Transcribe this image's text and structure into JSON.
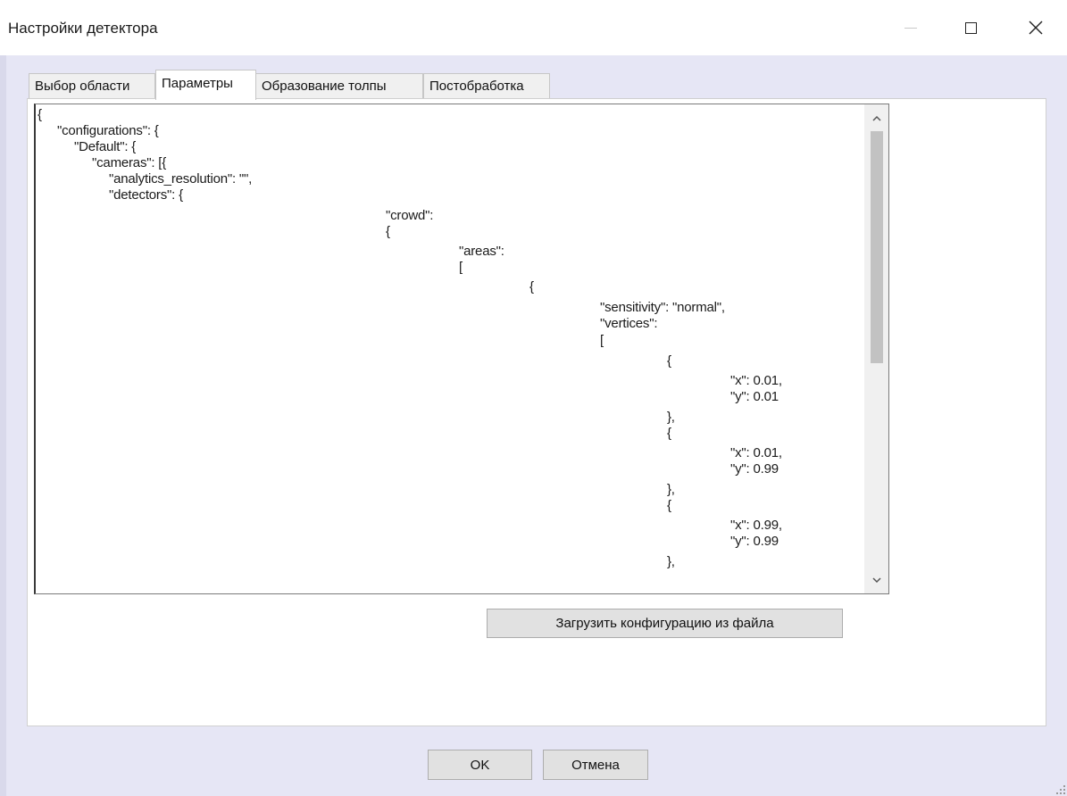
{
  "window": {
    "title": "Настройки детектора",
    "controls": {
      "minimize": "minimize-icon",
      "maximize": "maximize-icon",
      "close": "close-icon"
    }
  },
  "tabs": [
    {
      "label": "Выбор области",
      "active": false
    },
    {
      "label": "Параметры",
      "active": true
    },
    {
      "label": "Образование толпы",
      "active": false
    },
    {
      "label": "Постобработка",
      "active": false
    }
  ],
  "editor": {
    "lines": [
      "{",
      "\"configurations\": {",
      "\"Default\": {",
      "\"cameras\": [{",
      "\"analytics_resolution\": \"\",",
      "\"detectors\": {",
      "\"crowd\":",
      "{",
      "\"areas\":",
      "[",
      "{",
      "\"sensitivity\": \"normal\",",
      "\"vertices\":",
      "[",
      "{",
      "\"x\": 0.01,",
      "\"y\": 0.01",
      "},",
      "{",
      "\"x\": 0.01,",
      "\"y\": 0.99",
      "},",
      "{",
      "\"x\": 0.99,",
      "\"y\": 0.99",
      "},"
    ],
    "scrollbar": {
      "up": "chevron-up-icon",
      "down": "chevron-down-icon"
    }
  },
  "buttons": {
    "load_config": "Загрузить конфигурацию из файла",
    "ok": "OK",
    "cancel": "Отмена"
  },
  "colors": {
    "dialog_bg": "#e6e6f5",
    "panel_bg": "#ffffff",
    "button_bg": "#e1e1e1"
  }
}
